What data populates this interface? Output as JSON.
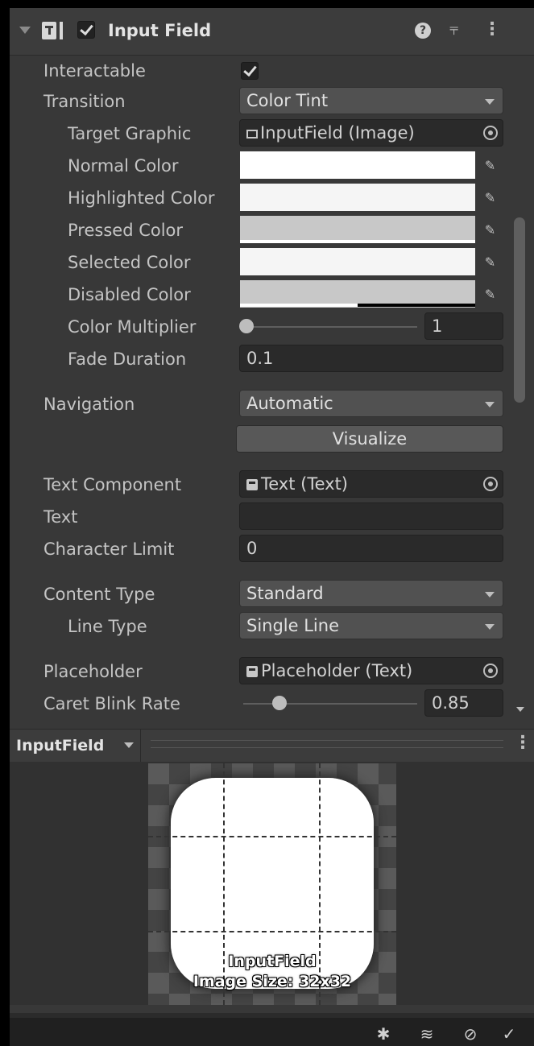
{
  "component": {
    "title": "Input Field",
    "enabled": true,
    "help_icon": "?",
    "preset_icon": "⫧",
    "menu_icon": "⋮"
  },
  "labels": {
    "interactable": "Interactable",
    "transition": "Transition",
    "target_graphic": "Target Graphic",
    "normal_color": "Normal Color",
    "highlighted_color": "Highlighted Color",
    "pressed_color": "Pressed Color",
    "selected_color": "Selected Color",
    "disabled_color": "Disabled Color",
    "color_multiplier": "Color Multiplier",
    "fade_duration": "Fade Duration",
    "navigation": "Navigation",
    "text_component": "Text Component",
    "text": "Text",
    "character_limit": "Character Limit",
    "content_type": "Content Type",
    "line_type": "Line Type",
    "placeholder": "Placeholder",
    "caret_blink_rate": "Caret Blink Rate"
  },
  "values": {
    "interactable": true,
    "transition": "Color Tint",
    "target_graphic": "InputField (Image)",
    "normal_color": "#ffffff",
    "highlighted_color": "#f5f5f5",
    "pressed_color": "#c8c8c8",
    "selected_color": "#f5f5f5",
    "disabled_color": "#c8c8c8",
    "disabled_alpha": 0.5,
    "color_multiplier": "1",
    "color_multiplier_fraction": 0.0,
    "fade_duration": "0.1",
    "navigation": "Automatic",
    "visualize_button": "Visualize",
    "text_component": "Text (Text)",
    "text": "",
    "character_limit": "0",
    "content_type": "Standard",
    "line_type": "Single Line",
    "placeholder": "Placeholder (Text)",
    "caret_blink_rate": "0.85",
    "caret_blink_fraction": 0.21
  },
  "preview": {
    "title": "InputField",
    "name": "InputField",
    "size": "Image Size: 32x32"
  },
  "statusbar": {
    "icons": [
      "debug-icon",
      "layers-icon",
      "visibility-icon",
      "check-circle-icon"
    ]
  }
}
